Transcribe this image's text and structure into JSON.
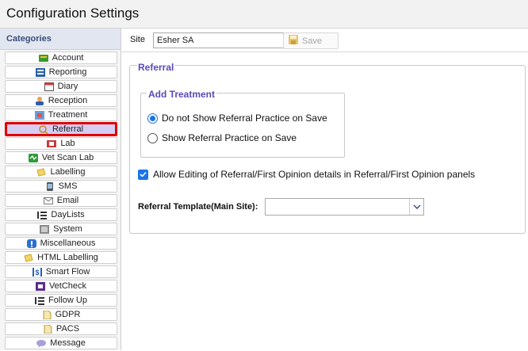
{
  "window": {
    "title": "Configuration Settings"
  },
  "sidebar": {
    "header": "Categories",
    "items": [
      {
        "label": "Account",
        "icon": "account-icon"
      },
      {
        "label": "Reporting",
        "icon": "reporting-icon"
      },
      {
        "label": "Diary",
        "icon": "calendar-icon"
      },
      {
        "label": "Reception",
        "icon": "person-icon"
      },
      {
        "label": "Treatment",
        "icon": "treatment-icon"
      },
      {
        "label": "Referral",
        "icon": "referral-icon",
        "selected": true
      },
      {
        "label": "Lab",
        "icon": "lab-icon"
      },
      {
        "label": "Vet Scan Lab",
        "icon": "vet-scan-icon"
      },
      {
        "label": "Labelling",
        "icon": "label-icon"
      },
      {
        "label": "SMS",
        "icon": "sms-icon"
      },
      {
        "label": "Email",
        "icon": "email-icon"
      },
      {
        "label": "DayLists",
        "icon": "list-icon"
      },
      {
        "label": "System",
        "icon": "system-icon"
      },
      {
        "label": "Miscellaneous",
        "icon": "info-icon"
      },
      {
        "label": "HTML Labelling",
        "icon": "label-icon"
      },
      {
        "label": "Smart Flow",
        "icon": "smart-flow-icon"
      },
      {
        "label": "VetCheck",
        "icon": "vetcheck-icon"
      },
      {
        "label": "Follow Up",
        "icon": "list-icon"
      },
      {
        "label": "GDPR",
        "icon": "document-icon"
      },
      {
        "label": "PACS",
        "icon": "document-icon"
      },
      {
        "label": "Message",
        "icon": "message-icon"
      }
    ]
  },
  "toolbar": {
    "site_label": "Site",
    "site_value": "Esher SA",
    "save_label": "Save"
  },
  "referral": {
    "section_title": "Referral",
    "group_title": "Add Treatment",
    "options": [
      {
        "label": "Do not Show Referral Practice on Save",
        "selected": true
      },
      {
        "label": "Show Referral Practice on Save",
        "selected": false
      }
    ],
    "allow_editing_label": "Allow Editing of Referral/First Opinion details in Referral/First Opinion panels",
    "allow_editing_checked": true,
    "template_label": "Referral Template(Main Site):",
    "template_value": ""
  },
  "colors": {
    "accent": "#1a73e8",
    "section_title": "#5a4ab8",
    "selected_bg": "#d5cdf2",
    "selected_border": "#e00000"
  }
}
